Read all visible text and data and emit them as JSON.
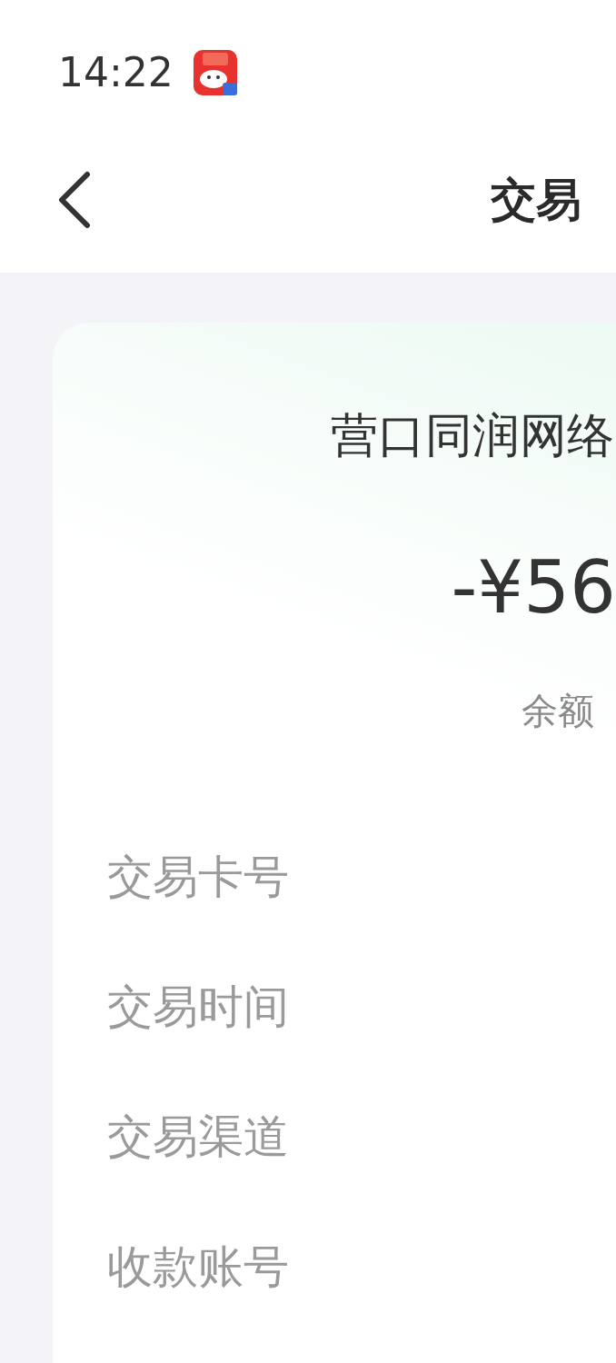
{
  "status_bar": {
    "time": "14:22"
  },
  "nav_bar": {
    "title": "交易"
  },
  "transaction": {
    "merchant": "营口同润网络",
    "amount": "-¥56",
    "balance": "余额"
  },
  "details": [
    {
      "label": "交易卡号"
    },
    {
      "label": "交易时间"
    },
    {
      "label": "交易渠道"
    },
    {
      "label": "收款账号"
    }
  ]
}
